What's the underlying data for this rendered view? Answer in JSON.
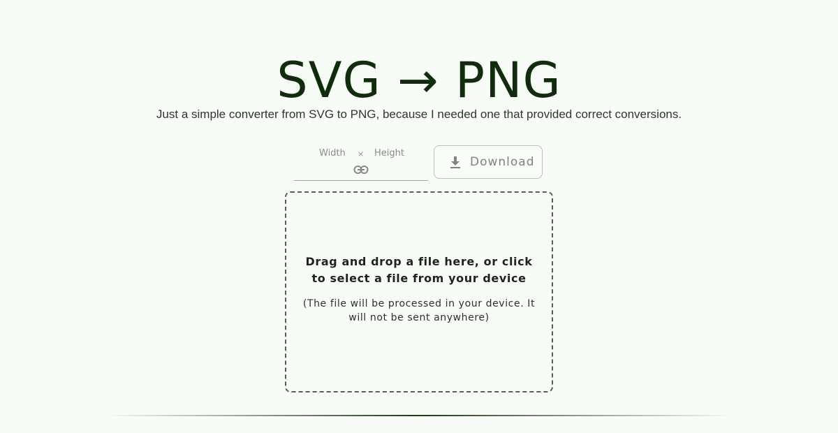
{
  "header": {
    "title": "SVG → PNG",
    "subtitle": "Just a simple converter from SVG to PNG, because I needed one that provided correct conversions."
  },
  "size_control": {
    "width_placeholder": "Width",
    "times_symbol": "×",
    "height_placeholder": "Height",
    "link_icon": "link-icon"
  },
  "download_button": {
    "label": "Download",
    "icon": "download-icon"
  },
  "dropzone": {
    "primary_text": "Drag and drop a file here, or click to select a file from your device",
    "secondary_text": "(The file will be processed in your device. It will not be sent anywhere)"
  },
  "colors": {
    "background": "#f7fcf6",
    "title": "#112c0c",
    "divider": "#1c3a16"
  }
}
